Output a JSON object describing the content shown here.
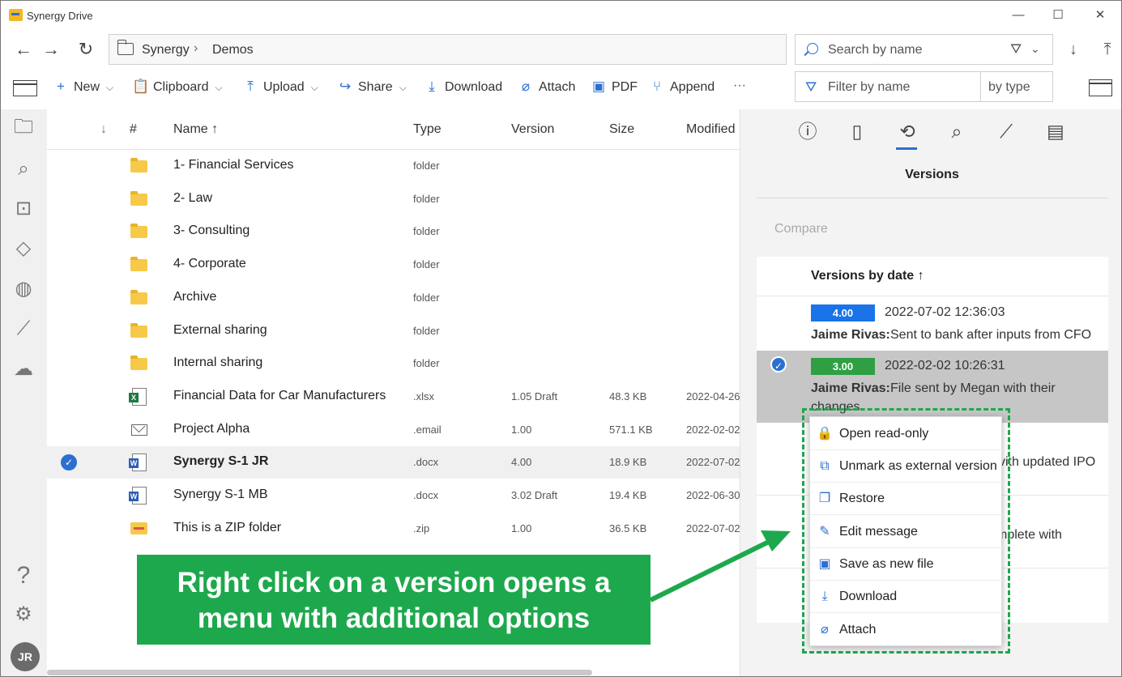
{
  "window": {
    "title": "Synergy Drive",
    "controls": [
      "—",
      "☐",
      "✕"
    ]
  },
  "address": {
    "crumbs": [
      "Synergy",
      "Demos"
    ],
    "search_placeholder": "Search by name"
  },
  "toolbar": {
    "new": "New",
    "clipboard": "Clipboard",
    "upload": "Upload",
    "share": "Share",
    "download": "Download",
    "attach": "Attach",
    "pdf": "PDF",
    "append": "Append",
    "more": "···",
    "filter_placeholder": "Filter by name",
    "filter_type": "by type"
  },
  "list": {
    "headers": {
      "sort_icon": "↓",
      "num": "#",
      "name": "Name ↑",
      "type": "Type",
      "version": "Version",
      "size": "Size",
      "modified": "Modified"
    },
    "rows": [
      {
        "name": "1- Financial Services",
        "type": "folder",
        "version": "",
        "size": "",
        "modified": "",
        "icon": "folder-icon"
      },
      {
        "name": "2- Law",
        "type": "folder",
        "version": "",
        "size": "",
        "modified": "",
        "icon": "folder-icon"
      },
      {
        "name": "3- Consulting",
        "type": "folder",
        "version": "",
        "size": "",
        "modified": "",
        "icon": "folder-icon"
      },
      {
        "name": "4- Corporate",
        "type": "folder",
        "version": "",
        "size": "",
        "modified": "",
        "icon": "folder-icon"
      },
      {
        "name": "Archive",
        "type": "folder",
        "version": "",
        "size": "",
        "modified": "",
        "icon": "folder-icon"
      },
      {
        "name": "External sharing",
        "type": "folder",
        "version": "",
        "size": "",
        "modified": "",
        "icon": "folder-icon"
      },
      {
        "name": "Internal sharing",
        "type": "folder",
        "version": "",
        "size": "",
        "modified": "",
        "icon": "folder-icon"
      },
      {
        "name": "Financial Data for Car Manufacturers",
        "type": ".xlsx",
        "version": "1.05 Draft",
        "size": "48.3 KB",
        "modified": "2022-04-26",
        "icon": "excel-file-icon"
      },
      {
        "name": "Project Alpha",
        "type": ".email",
        "version": "1.00",
        "size": "571.1 KB",
        "modified": "2022-02-02",
        "icon": "email-icon"
      },
      {
        "name": "Synergy S-1 JR",
        "type": ".docx",
        "version": "4.00",
        "size": "18.9 KB",
        "modified": "2022-07-02",
        "icon": "word-file-icon"
      },
      {
        "name": "Synergy S-1 MB",
        "type": ".docx",
        "version": "3.02 Draft",
        "size": "19.4 KB",
        "modified": "2022-06-30",
        "icon": "word-file-icon"
      },
      {
        "name": "This is a ZIP folder",
        "type": ".zip",
        "version": "1.00",
        "size": "36.5 KB",
        "modified": "2022-07-02",
        "icon": "zip-folder-icon"
      }
    ],
    "selected_index": 9
  },
  "rail": {
    "avatar": "JR",
    "help": "?"
  },
  "panel": {
    "title": "Versions",
    "compare": "Compare",
    "versions_header": "Versions by date ↑",
    "versions": [
      {
        "badge": "4.00",
        "badge_color": "#1a73e8",
        "date": "2022-07-02 12:36:03",
        "author": "Jaime Rivas:",
        "message": "Sent to bank after inputs from CFO",
        "message_cont": ""
      },
      {
        "badge": "3.00",
        "badge_color": "#2ea043",
        "date": "2022-02-02 10:26:31",
        "author": "Jaime Rivas:",
        "message": "File sent by Megan with their",
        "message_cont": "changes."
      }
    ],
    "hidden_fragments": [
      "vith updated IPO",
      "mplete with"
    ]
  },
  "menu": {
    "items": [
      {
        "label": "Open read-only",
        "icon": "lock-file-icon"
      },
      {
        "label": "Unmark as external version",
        "icon": "external-link-icon"
      },
      {
        "label": "Restore",
        "icon": "restore-icon"
      },
      {
        "label": "Edit message",
        "icon": "pencil-icon"
      },
      {
        "label": "Save as new file",
        "icon": "save-icon"
      },
      {
        "label": "Download",
        "icon": "download-icon"
      },
      {
        "label": "Attach",
        "icon": "paperclip-icon"
      }
    ]
  },
  "callout": {
    "line1": "Right click on a version opens a",
    "line2": "menu with additional options",
    "color": "#1ea84d"
  }
}
